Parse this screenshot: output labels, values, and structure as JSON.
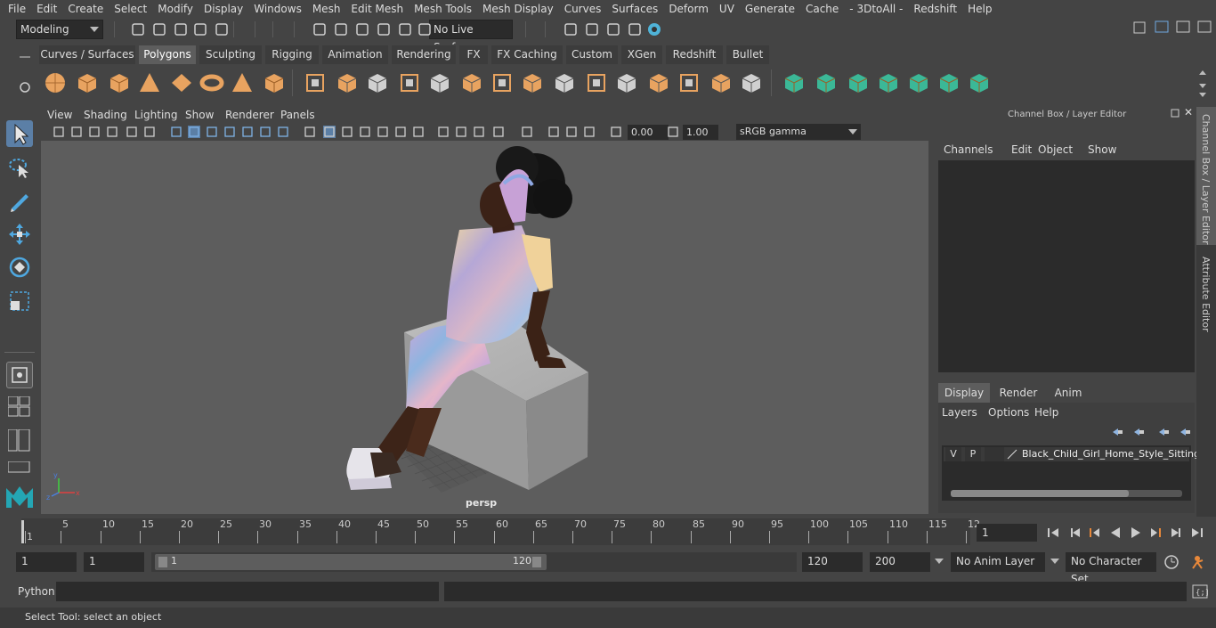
{
  "menubar": [
    "File",
    "Edit",
    "Create",
    "Select",
    "Modify",
    "Display",
    "Windows",
    "Mesh",
    "Edit Mesh",
    "Mesh Tools",
    "Mesh Display",
    "Curves",
    "Surfaces",
    "Deform",
    "UV",
    "Generate",
    "Cache",
    "- 3DtoAll -",
    "Redshift",
    "Help"
  ],
  "status": {
    "mode": "Modeling",
    "live_surface": "No Live Surface"
  },
  "shelf_tabs": [
    "Curves / Surfaces",
    "Polygons",
    "Sculpting",
    "Rigging",
    "Animation",
    "Rendering",
    "FX",
    "FX Caching",
    "Custom",
    "XGen",
    "Redshift",
    "Bullet"
  ],
  "shelf_active": "Polygons",
  "viewport": {
    "menu": [
      "View",
      "Shading",
      "Lighting",
      "Show",
      "Renderer",
      "Panels"
    ],
    "exposure": "0.00",
    "gamma": "1.00",
    "colorspace": "sRGB gamma",
    "camera_label": "persp"
  },
  "channelbox": {
    "title": "Channel Box / Layer Editor",
    "menu": [
      "Channels",
      "Edit",
      "Object",
      "Show"
    ],
    "layer_tabs": [
      "Display",
      "Render",
      "Anim"
    ],
    "layer_menu": [
      "Layers",
      "Options",
      "Help"
    ],
    "layer": {
      "v": "V",
      "p": "P",
      "name": "Black_Child_Girl_Home_Style_Sitting_"
    }
  },
  "side_tabs": [
    "Channel Box / Layer Editor",
    "Attribute Editor"
  ],
  "timeline": {
    "ticks": [
      "1",
      "5",
      "10",
      "15",
      "20",
      "25",
      "30",
      "35",
      "40",
      "45",
      "50",
      "55",
      "60",
      "65",
      "70",
      "75",
      "80",
      "85",
      "90",
      "95",
      "100",
      "105",
      "110",
      "115",
      "12"
    ],
    "current_frame": "1"
  },
  "range": {
    "start": "1",
    "start2": "1",
    "slider_start": "1",
    "slider_end": "120",
    "end": "120",
    "end2": "200",
    "anim_layer": "No Anim Layer",
    "char_set": "No Character Set"
  },
  "cmd": {
    "label": "Python"
  },
  "help": {
    "text": "Select Tool: select an object"
  },
  "colors": {
    "accent": "#5d5d5d",
    "active_tab": "#5d5d5d",
    "shelf_orange": "#e8a360",
    "shelf_teal": "#3bb897"
  }
}
